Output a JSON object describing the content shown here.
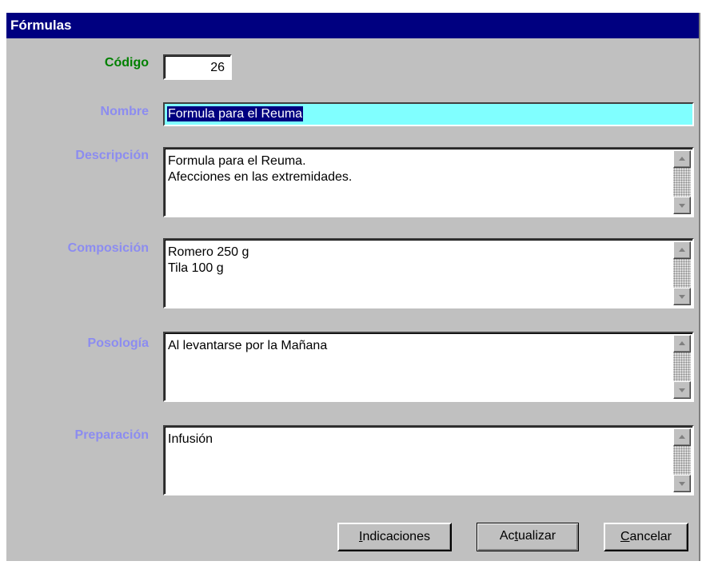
{
  "window": {
    "title": "Fórmulas"
  },
  "fields": {
    "codigo": {
      "label": "Código",
      "value": "26"
    },
    "nombre": {
      "label": "Nombre",
      "value": "Formula para el Reuma"
    },
    "descripcion": {
      "label": "Descripción",
      "value": "Formula para el Reuma.\nAfecciones en las extremidades."
    },
    "composicion": {
      "label": "Composición",
      "value": "Romero 250 g\nTila 100 g"
    },
    "posologia": {
      "label": "Posología",
      "value": "Al levantarse por la Mañana"
    },
    "preparacion": {
      "label": "Preparación",
      "value": "Infusión"
    }
  },
  "buttons": {
    "indicaciones": {
      "mnemonic": "I",
      "rest": "ndicaciones"
    },
    "actualizar": {
      "pre": "Ac",
      "mnemonic": "t",
      "rest": "ualizar"
    },
    "cancelar": {
      "mnemonic": "C",
      "rest": "ancelar"
    }
  },
  "colors": {
    "titlebar": "#000080",
    "label_active": "#008000",
    "label_inactive": "#8c8cf0",
    "nombre_field_bg": "#80ffff",
    "window_bg": "#c0c0c0"
  },
  "icons": [
    "scroll-up-arrow-icon",
    "scroll-down-arrow-icon"
  ]
}
